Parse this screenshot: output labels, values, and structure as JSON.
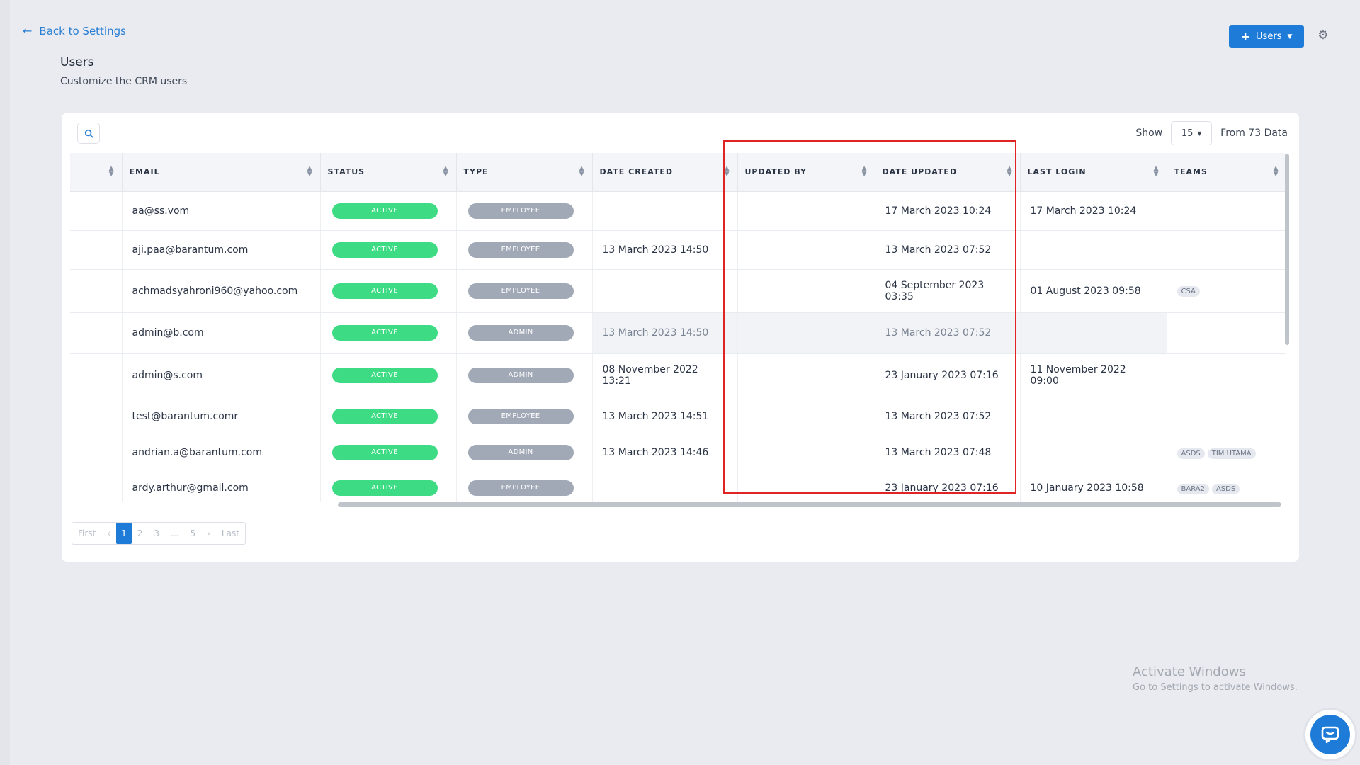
{
  "header": {
    "back_label": "Back to Settings",
    "title": "Users",
    "subtitle": "Customize the CRM users",
    "users_button": "Users"
  },
  "toolbar": {
    "show_label": "Show",
    "page_size": "15",
    "total_label": "From 73 Data"
  },
  "table": {
    "columns": [
      "",
      "EMAIL",
      "STATUS",
      "TYPE",
      "DATE CREATED",
      "UPDATED BY",
      "DATE UPDATED",
      "LAST LOGIN",
      "TEAMS"
    ],
    "rows": [
      {
        "email": "aa@ss.vom",
        "status": "ACTIVE",
        "type": "EMPLOYEE",
        "created": "",
        "updated_by": "",
        "updated": "17 March 2023 10:24",
        "last_login": "17 March 2023 10:24",
        "teams": []
      },
      {
        "email": "aji.paa@barantum.com",
        "status": "ACTIVE",
        "type": "EMPLOYEE",
        "created": "13 March 2023 14:50",
        "updated_by": "",
        "updated": "13 March 2023 07:52",
        "last_login": "",
        "teams": []
      },
      {
        "email": "achmadsyahroni960@yahoo.com",
        "status": "ACTIVE",
        "type": "EMPLOYEE",
        "created": "",
        "updated_by": "",
        "updated": "04 September 2023 03:35",
        "last_login": "01 August 2023 09:58",
        "teams": [
          "CSA"
        ]
      },
      {
        "email": "admin@b.com",
        "status": "ACTIVE",
        "type": "ADMIN",
        "created": "13 March 2023 14:50",
        "updated_by": "",
        "updated": "13 March 2023 07:52",
        "last_login": "",
        "teams": []
      },
      {
        "email": "admin@s.com",
        "status": "ACTIVE",
        "type": "ADMIN",
        "created": "08 November 2022 13:21",
        "updated_by": "",
        "updated": "23 January 2023 07:16",
        "last_login": "11 November 2022 09:00",
        "teams": []
      },
      {
        "email": "test@barantum.comr",
        "status": "ACTIVE",
        "type": "EMPLOYEE",
        "created": "13 March 2023 14:51",
        "updated_by": "",
        "updated": "13 March 2023 07:52",
        "last_login": "",
        "teams": []
      },
      {
        "email": "andrian.a@barantum.com",
        "status": "ACTIVE",
        "type": "ADMIN",
        "created": "13 March 2023 14:46",
        "updated_by": "",
        "updated": "13 March 2023 07:48",
        "last_login": "",
        "teams": [
          "ASDS",
          "TIM UTAMA"
        ]
      },
      {
        "email": "ardy.arthur@gmail.com",
        "status": "ACTIVE",
        "type": "EMPLOYEE",
        "created": "",
        "updated_by": "",
        "updated": "23 January 2023 07:16",
        "last_login": "10 January 2023 10:58",
        "teams": [
          "BARA2",
          "ASDS"
        ]
      }
    ]
  },
  "pagination": {
    "first": "First",
    "prev": "‹",
    "pages": [
      "1",
      "2",
      "3",
      "...",
      "5"
    ],
    "next": "›",
    "last": "Last"
  },
  "watermark": {
    "line1": "Activate Windows",
    "line2": "Go to Settings to activate Windows."
  },
  "colors": {
    "accent": "#1e7bd8",
    "active": "#3ddc84",
    "type_pill": "#a1a8b6",
    "highlight": "#e02424"
  }
}
